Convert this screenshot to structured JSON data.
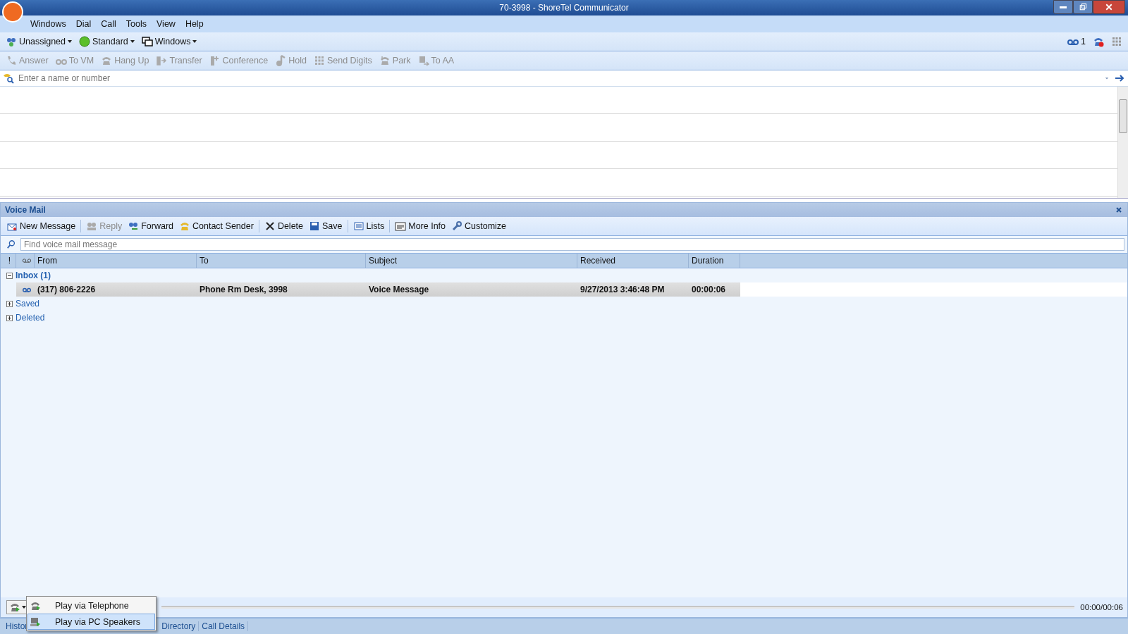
{
  "window": {
    "title": "70-3998 - ShoreTel Communicator"
  },
  "menu": [
    {
      "label": "Windows"
    },
    {
      "label": "Dial"
    },
    {
      "label": "Call"
    },
    {
      "label": "Tools"
    },
    {
      "label": "View"
    },
    {
      "label": "Help"
    }
  ],
  "status_toolbar": {
    "items": [
      {
        "label": "Unassigned"
      },
      {
        "label": "Standard"
      },
      {
        "label": "Windows"
      }
    ],
    "voicemail_count": "1"
  },
  "call_toolbar": [
    {
      "label": "Answer",
      "disabled": true
    },
    {
      "label": "To VM",
      "disabled": true
    },
    {
      "label": "Hang Up",
      "disabled": true
    },
    {
      "label": "Transfer",
      "disabled": true
    },
    {
      "label": "Conference",
      "disabled": true
    },
    {
      "label": "Hold",
      "disabled": true
    },
    {
      "label": "Send Digits",
      "disabled": true
    },
    {
      "label": "Park",
      "disabled": true
    },
    {
      "label": "To AA",
      "disabled": true
    }
  ],
  "dial": {
    "placeholder": "Enter a name or number"
  },
  "voice_mail": {
    "title": "Voice Mail",
    "toolbar": [
      {
        "label": "New Message",
        "disabled": false,
        "separator_after": true
      },
      {
        "label": "Reply",
        "disabled": true,
        "separator_after": false
      },
      {
        "label": "Forward",
        "disabled": false,
        "separator_after": false
      },
      {
        "label": "Contact Sender",
        "disabled": false,
        "separator_after": true
      },
      {
        "label": "Delete",
        "disabled": false,
        "separator_after": false
      },
      {
        "label": "Save",
        "disabled": false,
        "separator_after": true
      },
      {
        "label": "Lists",
        "disabled": false,
        "separator_after": true
      },
      {
        "label": "More Info",
        "disabled": false,
        "separator_after": false
      },
      {
        "label": "Customize",
        "disabled": false,
        "separator_after": false
      }
    ],
    "search": {
      "placeholder": "Find voice mail message"
    },
    "flag_column": "!",
    "columns": [
      "From",
      "To",
      "Subject",
      "Received",
      "Duration"
    ],
    "groups": [
      {
        "label": "Inbox (1)",
        "expanded": true,
        "unread": true,
        "messages": [
          {
            "from": "(317) 806-2226",
            "to": "Phone Rm Desk, 3998",
            "subject": "Voice Message",
            "received": "9/27/2013 3:46:48 PM",
            "duration": "00:00:06",
            "unread": true,
            "selected": true
          }
        ]
      },
      {
        "label": "Saved",
        "expanded": false,
        "unread": false
      },
      {
        "label": "Deleted",
        "expanded": false,
        "unread": false
      }
    ],
    "player": {
      "time": "00:00/00:06"
    },
    "play_menu": [
      {
        "label": "Play via Telephone",
        "selected": false
      },
      {
        "label": "Play via PC Speakers",
        "selected": true
      }
    ]
  },
  "bottom_tabs": [
    {
      "label": "Histor"
    },
    {
      "label": "Directory"
    },
    {
      "label": "Call Details"
    }
  ]
}
